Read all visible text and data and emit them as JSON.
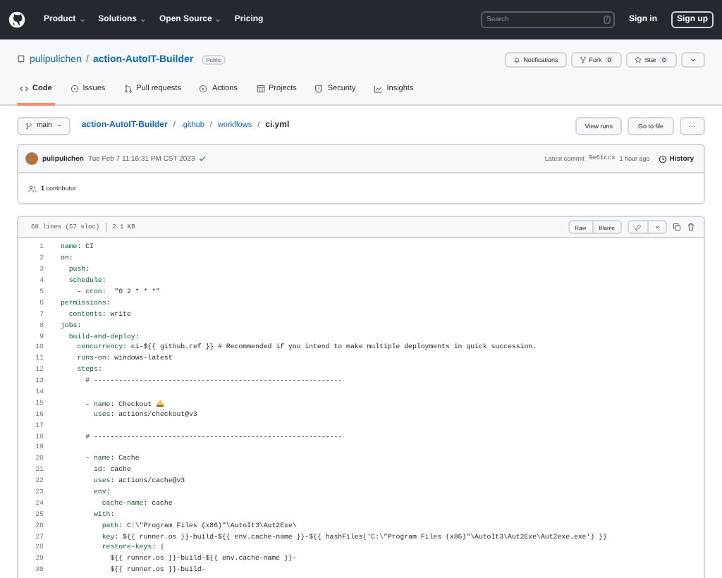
{
  "top_nav": {
    "items": [
      {
        "label": "Product",
        "dropdown": true
      },
      {
        "label": "Solutions",
        "dropdown": true
      },
      {
        "label": "Open Source",
        "dropdown": true
      },
      {
        "label": "Pricing",
        "dropdown": false
      }
    ],
    "search": {
      "placeholder": "Search",
      "shortcut": "/"
    },
    "sign_in": "Sign in",
    "sign_up": "Sign up"
  },
  "repo": {
    "owner": "pulipulichen",
    "separator": "/",
    "name": "action-AutoIT-Builder",
    "visibility": "Public",
    "notifications": "Notifications",
    "fork": {
      "label": "Fork",
      "count": "0"
    },
    "star": {
      "label": "Star",
      "count": "0"
    }
  },
  "tabs": [
    {
      "label": "Code",
      "kind": "code",
      "selected": true
    },
    {
      "label": "Issues",
      "kind": "issue",
      "selected": false
    },
    {
      "label": "Pull requests",
      "kind": "pr",
      "selected": false
    },
    {
      "label": "Actions",
      "kind": "play",
      "selected": false
    },
    {
      "label": "Projects",
      "kind": "table",
      "selected": false
    },
    {
      "label": "Security",
      "kind": "shield",
      "selected": false
    },
    {
      "label": "Insights",
      "kind": "graph",
      "selected": false
    }
  ],
  "breadcrumb": {
    "branch": "main",
    "path": [
      {
        "label": "action-AutoIT-Builder",
        "kind": "repo"
      },
      {
        "label": ".github",
        "kind": "dir"
      },
      {
        "label": "workflows",
        "kind": "dir"
      },
      {
        "label": "ci.yml",
        "kind": "file"
      }
    ],
    "separator": "/",
    "buttons": [
      "View runs",
      "Go to file"
    ],
    "more": "···"
  },
  "commit": {
    "author": "pulipulichen",
    "message": "Tue Feb 7 11:16:31 PM CST 2023",
    "passed": true,
    "latest_label": "Latest commit",
    "hash": "9e61ccs",
    "age": "1 hour ago",
    "history": "History"
  },
  "contributors": {
    "count": "1",
    "label": "contributor"
  },
  "file": {
    "lines_info": "68 lines (57 sloc)",
    "size": "2.1 KB",
    "buttons": [
      "Raw",
      "Blame"
    ],
    "lines": [
      {
        "number": "1",
        "code": "name: CI"
      },
      {
        "number": "2",
        "code": "on:"
      },
      {
        "number": "3",
        "code": "  push:"
      },
      {
        "number": "4",
        "code": "  schedule:"
      },
      {
        "number": "5",
        "code": "    - cron:  \"0 2 * * *\""
      },
      {
        "number": "6",
        "code": "permissions:"
      },
      {
        "number": "7",
        "code": "  contents: write"
      },
      {
        "number": "8",
        "code": "jobs:"
      },
      {
        "number": "9",
        "code": "  build-and-deploy:"
      },
      {
        "number": "10",
        "code": "    concurrency: ci-${{ github.ref }} # Recommended if you intend to make multiple deployments in quick succession."
      },
      {
        "number": "11",
        "code": "    runs-on: windows-latest"
      },
      {
        "number": "12",
        "code": "    steps:"
      },
      {
        "number": "13",
        "code": "      # ------------------------------------------------------------"
      },
      {
        "number": "14"
      },
      {
        "number": "15",
        "code": "      - name: Checkout 🛎️"
      },
      {
        "number": "16",
        "code": "        uses: actions/checkout@v3"
      },
      {
        "number": "17"
      },
      {
        "number": "18",
        "code": "      # ------------------------------------------------------------"
      },
      {
        "number": "19"
      },
      {
        "number": "20",
        "code": "      - name: Cache"
      },
      {
        "number": "21",
        "code": "        id: cache"
      },
      {
        "number": "22",
        "code": "        uses: actions/cache@v3"
      },
      {
        "number": "23",
        "code": "        env:"
      },
      {
        "number": "24",
        "code": "          cache-name: cache"
      },
      {
        "number": "25",
        "code": "        with:"
      },
      {
        "number": "26",
        "code": "          path: C:\\\"Program Files (x86)\"\\AutoIt3\\Aut2Exe\\"
      },
      {
        "number": "27",
        "code": "          key: ${{ runner.os }}-build-${{ env.cache-name }}-${{ hashFiles('C:\\\"Program Files (x86)\"\\AutoIt3\\Aut2Exe\\Aut2exe.exe') }}"
      },
      {
        "number": "28",
        "code": "          restore-keys: |"
      },
      {
        "number": "29",
        "code": "            ${{ runner.os }}-build-${{ env.cache-name }}-"
      },
      {
        "number": "30",
        "code": "            ${{ runner.os }}-build-"
      }
    ]
  }
}
